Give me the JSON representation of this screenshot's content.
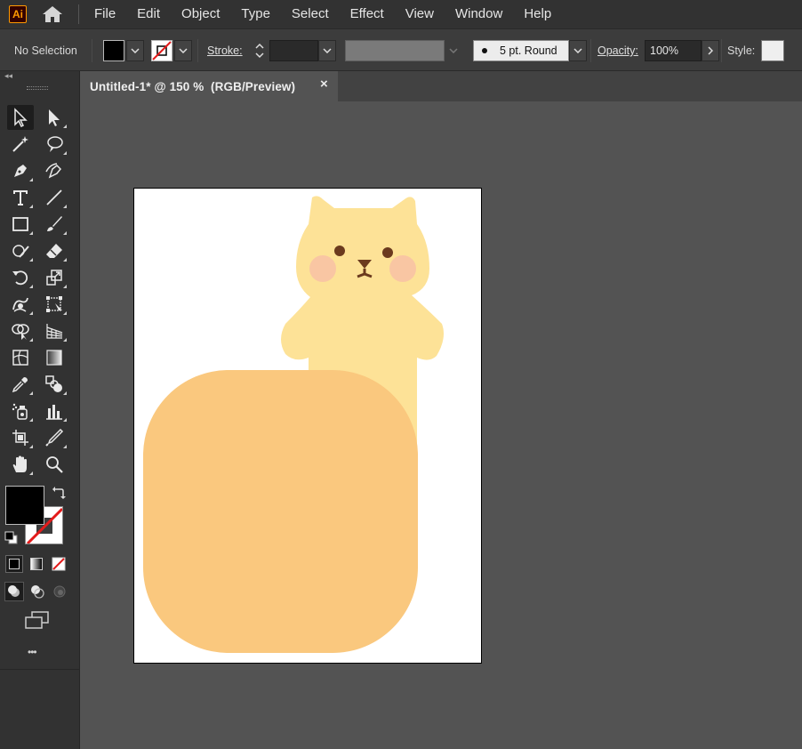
{
  "app": {
    "logo_text": "Ai"
  },
  "menu": {
    "items": [
      {
        "id": "file",
        "label": "File"
      },
      {
        "id": "edit",
        "label": "Edit"
      },
      {
        "id": "object",
        "label": "Object"
      },
      {
        "id": "type",
        "label": "Type"
      },
      {
        "id": "select",
        "label": "Select"
      },
      {
        "id": "effect",
        "label": "Effect"
      },
      {
        "id": "view",
        "label": "View"
      },
      {
        "id": "window",
        "label": "Window"
      },
      {
        "id": "help",
        "label": "Help"
      }
    ]
  },
  "control_bar": {
    "selection_status": "No Selection",
    "fill_color": "#000000",
    "stroke_label": "Stroke:",
    "brush_label": "5 pt. Round",
    "opacity_label": "Opacity:",
    "opacity_value": "100%",
    "style_label": "Style:"
  },
  "document": {
    "tab_title": "Untitled-1* @ 150 %  (RGB/Preview)",
    "close_glyph": "×"
  },
  "colors": {
    "accent_logo": "#ff9a00",
    "cat_body": "#fde297",
    "cat_cheek": "#f9c6a3",
    "cat_features": "#6b3a1e",
    "rounded_rect": "#fac87e",
    "artboard": "#ffffff",
    "workspace": "#535353"
  },
  "toolbar": {
    "tools": [
      "selection-tool-icon",
      "direct-selection-tool-icon",
      "magic-wand-tool-icon",
      "lasso-tool-icon",
      "pen-tool-icon",
      "curvature-tool-icon",
      "type-tool-icon",
      "line-segment-tool-icon",
      "rectangle-tool-icon",
      "paintbrush-tool-icon",
      "shaper-tool-icon",
      "eraser-tool-icon",
      "rotate-tool-icon",
      "scale-tool-icon",
      "warp-tool-icon",
      "free-transform-tool-icon",
      "shape-builder-tool-icon",
      "perspective-grid-tool-icon",
      "mesh-tool-icon",
      "gradient-tool-icon",
      "eyedropper-tool-icon",
      "blend-tool-icon",
      "symbol-sprayer-tool-icon",
      "column-graph-tool-icon",
      "artboard-tool-icon",
      "slice-tool-icon",
      "hand-tool-icon",
      "zoom-tool-icon"
    ],
    "more_glyph": "•••"
  }
}
